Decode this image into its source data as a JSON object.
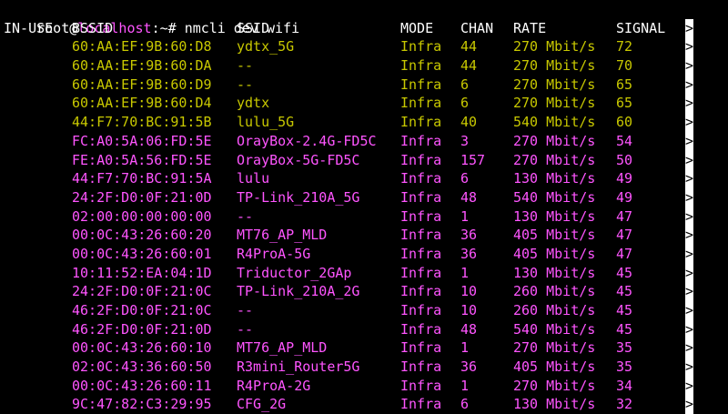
{
  "terminal": {
    "prompt": {
      "user": "root",
      "at": "@",
      "host": "localhost",
      "suffix": ":~# ",
      "command": "nmcli dev wifi"
    },
    "colors": {
      "background": "#000000",
      "text": "#ffffff",
      "host": "#ff55ff",
      "yellow_rows": "#c8c800",
      "magenta_rows": "#ff55ff"
    },
    "headers": {
      "in_use": "IN-USE",
      "bssid": "BSSID",
      "ssid": "SSID",
      "mode": "MODE",
      "chan": "CHAN",
      "rate": "RATE",
      "signal": "SIGNAL",
      "bars": ">"
    },
    "rows": [
      {
        "bssid": "60:AA:EF:9B:60:D8",
        "ssid": "ydtx_5G",
        "mode": "Infra",
        "chan": "44",
        "rate": "270 Mbit/s",
        "signal": "72",
        "bars": ">",
        "color": "yellow"
      },
      {
        "bssid": "60:AA:EF:9B:60:DA",
        "ssid": "--",
        "mode": "Infra",
        "chan": "44",
        "rate": "270 Mbit/s",
        "signal": "70",
        "bars": ">",
        "color": "yellow"
      },
      {
        "bssid": "60:AA:EF:9B:60:D9",
        "ssid": "--",
        "mode": "Infra",
        "chan": "6",
        "rate": "270 Mbit/s",
        "signal": "65",
        "bars": ">",
        "color": "yellow"
      },
      {
        "bssid": "60:AA:EF:9B:60:D4",
        "ssid": "ydtx",
        "mode": "Infra",
        "chan": "6",
        "rate": "270 Mbit/s",
        "signal": "65",
        "bars": ">",
        "color": "yellow"
      },
      {
        "bssid": "44:F7:70:BC:91:5B",
        "ssid": "lulu_5G",
        "mode": "Infra",
        "chan": "40",
        "rate": "540 Mbit/s",
        "signal": "60",
        "bars": ">",
        "color": "yellow"
      },
      {
        "bssid": "FC:A0:5A:06:FD:5E",
        "ssid": "OrayBox-2.4G-FD5C",
        "mode": "Infra",
        "chan": "3",
        "rate": "270 Mbit/s",
        "signal": "54",
        "bars": ">",
        "color": "magenta"
      },
      {
        "bssid": "FE:A0:5A:56:FD:5E",
        "ssid": "OrayBox-5G-FD5C",
        "mode": "Infra",
        "chan": "157",
        "rate": "270 Mbit/s",
        "signal": "50",
        "bars": ">",
        "color": "magenta"
      },
      {
        "bssid": "44:F7:70:BC:91:5A",
        "ssid": "lulu",
        "mode": "Infra",
        "chan": "6",
        "rate": "130 Mbit/s",
        "signal": "49",
        "bars": ">",
        "color": "magenta"
      },
      {
        "bssid": "24:2F:D0:0F:21:0D",
        "ssid": "TP-Link_210A_5G",
        "mode": "Infra",
        "chan": "48",
        "rate": "540 Mbit/s",
        "signal": "49",
        "bars": ">",
        "color": "magenta"
      },
      {
        "bssid": "02:00:00:00:00:00",
        "ssid": "--",
        "mode": "Infra",
        "chan": "1",
        "rate": "130 Mbit/s",
        "signal": "47",
        "bars": ">",
        "color": "magenta"
      },
      {
        "bssid": "00:0C:43:26:60:20",
        "ssid": "MT76_AP_MLD",
        "mode": "Infra",
        "chan": "36",
        "rate": "405 Mbit/s",
        "signal": "47",
        "bars": ">",
        "color": "magenta"
      },
      {
        "bssid": "00:0C:43:26:60:01",
        "ssid": "R4ProA-5G",
        "mode": "Infra",
        "chan": "36",
        "rate": "405 Mbit/s",
        "signal": "47",
        "bars": ">",
        "color": "magenta"
      },
      {
        "bssid": "10:11:52:EA:04:1D",
        "ssid": "Triductor_2GAp",
        "mode": "Infra",
        "chan": "1",
        "rate": "130 Mbit/s",
        "signal": "45",
        "bars": ">",
        "color": "magenta"
      },
      {
        "bssid": "24:2F:D0:0F:21:0C",
        "ssid": "TP-Link_210A_2G",
        "mode": "Infra",
        "chan": "10",
        "rate": "260 Mbit/s",
        "signal": "45",
        "bars": ">",
        "color": "magenta"
      },
      {
        "bssid": "46:2F:D0:0F:21:0C",
        "ssid": "--",
        "mode": "Infra",
        "chan": "10",
        "rate": "260 Mbit/s",
        "signal": "45",
        "bars": ">",
        "color": "magenta"
      },
      {
        "bssid": "46:2F:D0:0F:21:0D",
        "ssid": "--",
        "mode": "Infra",
        "chan": "48",
        "rate": "540 Mbit/s",
        "signal": "45",
        "bars": ">",
        "color": "magenta"
      },
      {
        "bssid": "00:0C:43:26:60:10",
        "ssid": "MT76_AP_MLD",
        "mode": "Infra",
        "chan": "1",
        "rate": "270 Mbit/s",
        "signal": "35",
        "bars": ">",
        "color": "magenta"
      },
      {
        "bssid": "02:0C:43:36:60:50",
        "ssid": "R3mini_Router5G",
        "mode": "Infra",
        "chan": "36",
        "rate": "405 Mbit/s",
        "signal": "35",
        "bars": ">",
        "color": "magenta"
      },
      {
        "bssid": "00:0C:43:26:60:11",
        "ssid": "R4ProA-2G",
        "mode": "Infra",
        "chan": "1",
        "rate": "270 Mbit/s",
        "signal": "34",
        "bars": ">",
        "color": "magenta"
      },
      {
        "bssid": "9C:47:82:C3:29:95",
        "ssid": "CFG_2G",
        "mode": "Infra",
        "chan": "6",
        "rate": "130 Mbit/s",
        "signal": "32",
        "bars": ">",
        "color": "magenta"
      }
    ]
  }
}
